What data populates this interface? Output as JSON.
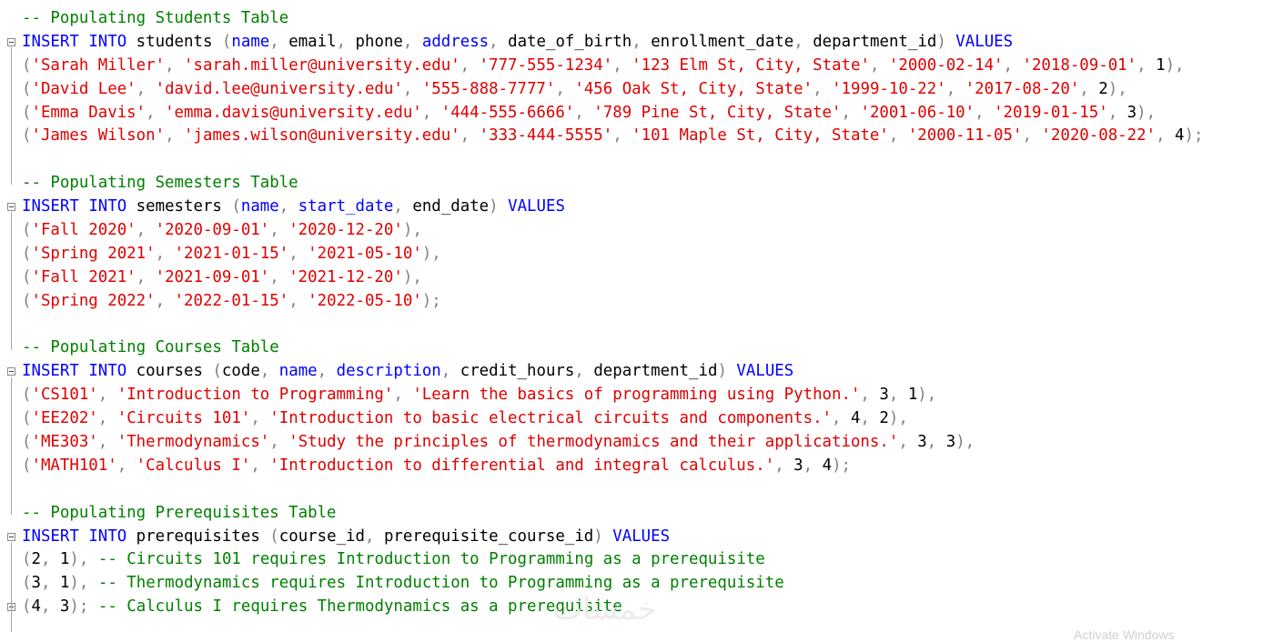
{
  "students_block": {
    "comment": "-- Populating Students Table",
    "table": "students",
    "columns": [
      "name",
      "email",
      "phone",
      "address",
      "date_of_birth",
      "enrollment_date",
      "department_id"
    ],
    "rows": [
      [
        "'Sarah Miller'",
        "'sarah.miller@university.edu'",
        "'777-555-1234'",
        "'123 Elm St, City, State'",
        "'2000-02-14'",
        "'2018-09-01'",
        "1"
      ],
      [
        "'David Lee'",
        "'david.lee@university.edu'",
        "'555-888-7777'",
        "'456 Oak St, City, State'",
        "'1999-10-22'",
        "'2017-08-20'",
        "2"
      ],
      [
        "'Emma Davis'",
        "'emma.davis@university.edu'",
        "'444-555-6666'",
        "'789 Pine St, City, State'",
        "'2001-06-10'",
        "'2019-01-15'",
        "3"
      ],
      [
        "'James Wilson'",
        "'james.wilson@university.edu'",
        "'333-444-5555'",
        "'101 Maple St, City, State'",
        "'2000-11-05'",
        "'2020-08-22'",
        "4"
      ]
    ]
  },
  "semesters_block": {
    "comment": "-- Populating Semesters Table",
    "table": "semesters",
    "columns": [
      "name",
      "start_date",
      "end_date"
    ],
    "rows": [
      [
        "'Fall 2020'",
        "'2020-09-01'",
        "'2020-12-20'"
      ],
      [
        "'Spring 2021'",
        "'2021-01-15'",
        "'2021-05-10'"
      ],
      [
        "'Fall 2021'",
        "'2021-09-01'",
        "'2021-12-20'"
      ],
      [
        "'Spring 2022'",
        "'2022-01-15'",
        "'2022-05-10'"
      ]
    ]
  },
  "courses_block": {
    "comment": "-- Populating Courses Table",
    "table": "courses",
    "columns": [
      "code",
      "name",
      "description",
      "credit_hours",
      "department_id"
    ],
    "rows": [
      [
        "'CS101'",
        "'Introduction to Programming'",
        "'Learn the basics of programming using Python.'",
        "3",
        "1"
      ],
      [
        "'EE202'",
        "'Circuits 101'",
        "'Introduction to basic electrical circuits and components.'",
        "4",
        "2"
      ],
      [
        "'ME303'",
        "'Thermodynamics'",
        "'Study the principles of thermodynamics and their applications.'",
        "3",
        "3"
      ],
      [
        "'MATH101'",
        "'Calculus I'",
        "'Introduction to differential and integral calculus.'",
        "3",
        "4"
      ]
    ]
  },
  "prereq_block": {
    "comment": "-- Populating Prerequisites Table",
    "table": "prerequisites",
    "columns": [
      "course_id",
      "prerequisite_course_id"
    ],
    "rows": [
      {
        "values": [
          "2",
          "1"
        ],
        "comment": "-- Circuits 101 requires Introduction to Programming as a prerequisite"
      },
      {
        "values": [
          "3",
          "1"
        ],
        "comment": "-- Thermodynamics requires Introduction to Programming as a prerequisite"
      },
      {
        "values": [
          "4",
          "3"
        ],
        "comment": "-- Calculus I requires Thermodynamics as a prerequisite"
      }
    ]
  },
  "keywords": {
    "insert": "INSERT",
    "into": "INTO",
    "values": "VALUES"
  },
  "highlighted_identifiers": [
    "name",
    "address",
    "start_date",
    "description"
  ],
  "colors": {
    "keyword": "#0000ff",
    "string": "#e00000",
    "comment": "#008000",
    "punctuation": "#808080",
    "background": "#ffffff"
  },
  "watermark": "خمسات",
  "activation_notice": "Activate Windows"
}
